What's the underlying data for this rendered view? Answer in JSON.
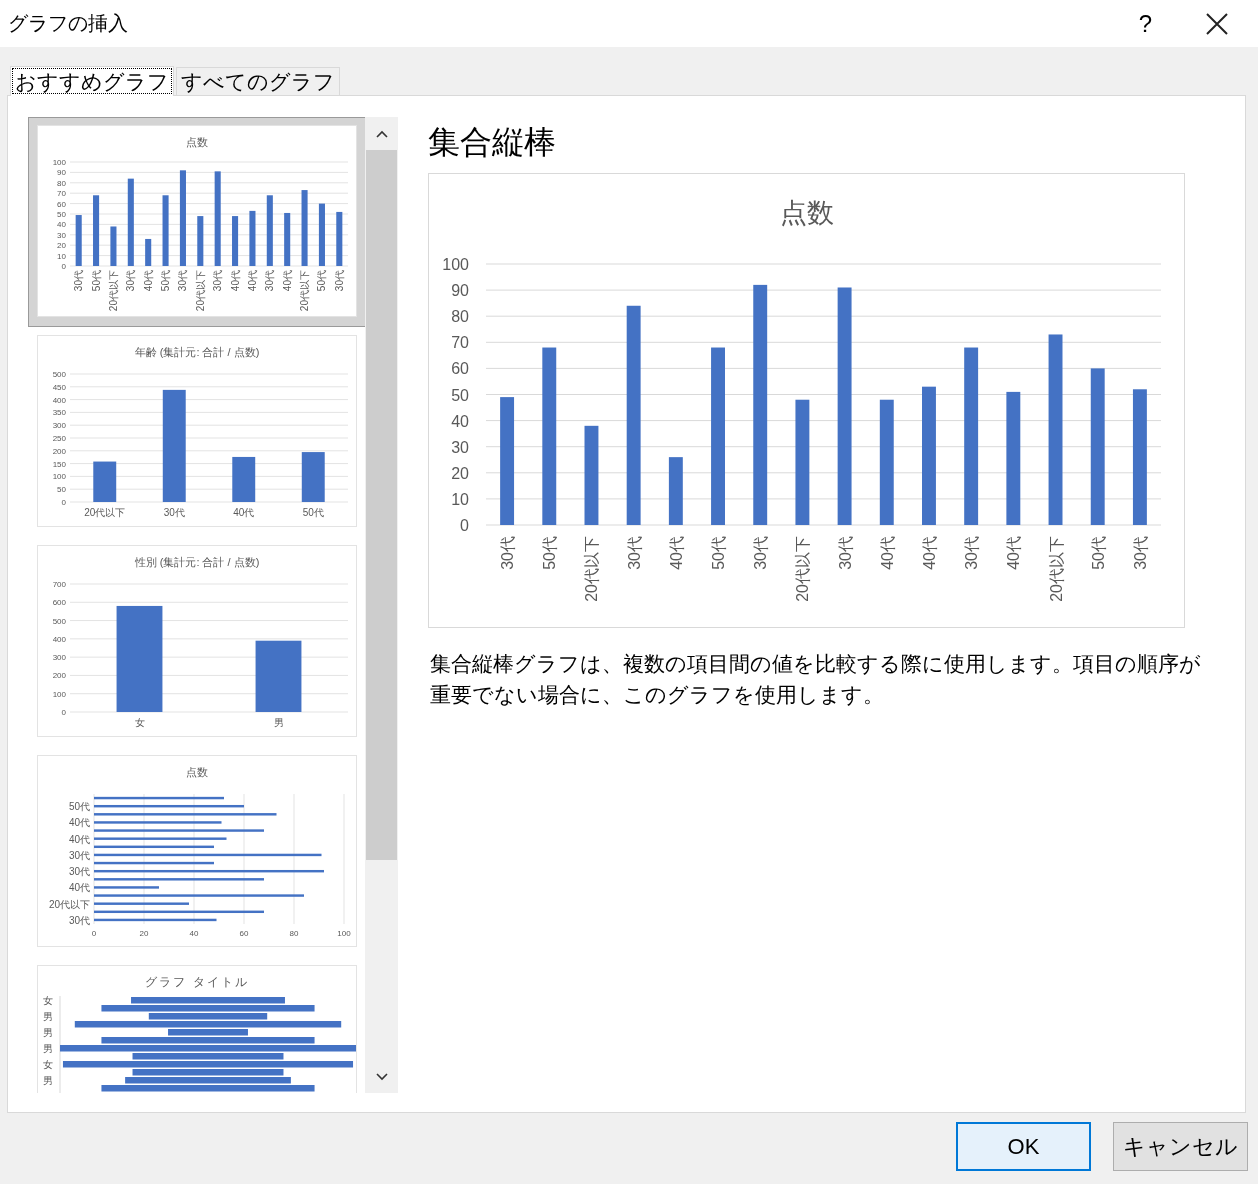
{
  "window": {
    "title": "グラフの挿入",
    "help": "?"
  },
  "tabs": [
    {
      "label": "おすすめグラフ",
      "selected": true
    },
    {
      "label": "すべてのグラフ",
      "selected": false
    }
  ],
  "recommendations": [
    {
      "kind": "chart",
      "selected": true,
      "chart_data": {
        "type": "bar",
        "orientation": "vertical",
        "grid": true,
        "title": "点数",
        "categories": [
          "30代",
          "50代",
          "20代以下",
          "30代",
          "40代",
          "50代",
          "30代",
          "20代以下",
          "30代",
          "40代",
          "40代",
          "30代",
          "40代",
          "20代以下",
          "50代",
          "30代"
        ],
        "series": [
          {
            "color": "#4472c4",
            "values": [
              49,
              68,
              38,
              84,
              26,
              68,
              92,
              48,
              91,
              48,
              53,
              68,
              51,
              73,
              60,
              52
            ]
          }
        ],
        "ylim": [
          0,
          100
        ],
        "yticks": [
          0,
          10,
          20,
          30,
          40,
          50,
          60,
          70,
          80,
          90,
          100
        ]
      }
    },
    {
      "kind": "chart",
      "selected": false,
      "chart_data": {
        "type": "bar",
        "orientation": "vertical",
        "grid": true,
        "title": "年齢 (集計元: 合計 / 点数)",
        "categories": [
          "20代以下",
          "30代",
          "40代",
          "50代"
        ],
        "series": [
          {
            "color": "#4472c4",
            "values": [
              158,
              438,
              176,
              195
            ]
          }
        ],
        "ylim": [
          0,
          500
        ],
        "yticks": [
          0,
          50,
          100,
          150,
          200,
          250,
          300,
          350,
          400,
          450,
          500
        ]
      }
    },
    {
      "kind": "chart",
      "selected": false,
      "chart_data": {
        "type": "bar",
        "orientation": "vertical",
        "grid": true,
        "title": "性別 (集計元: 合計 / 点数)",
        "categories": [
          "女",
          "男"
        ],
        "series": [
          {
            "color": "#4472c4",
            "values": [
              580,
              390
            ]
          }
        ],
        "ylim": [
          0,
          700
        ],
        "yticks": [
          0,
          100,
          200,
          300,
          400,
          500,
          600,
          700
        ]
      }
    },
    {
      "kind": "chart",
      "selected": false,
      "chart_data": {
        "type": "bar",
        "orientation": "horizontal",
        "grid": true,
        "title": "点数",
        "categories": [
          null,
          "50代",
          null,
          "40代",
          null,
          "40代",
          null,
          "30代",
          null,
          "30代",
          null,
          "40代",
          null,
          "20代以下",
          null,
          "30代"
        ],
        "series": [
          {
            "color": "#4472c4",
            "values": [
              52,
              60,
              73,
              51,
              68,
              53,
              48,
              91,
              48,
              92,
              68,
              26,
              84,
              38,
              68,
              49
            ]
          }
        ],
        "xlim": [
          0,
          100
        ],
        "xticks": [
          0,
          20,
          40,
          60,
          80,
          100
        ]
      }
    },
    {
      "kind": "pyramid",
      "selected": false,
      "title": "グラフ タイトル",
      "labels": [
        "女",
        "男",
        "男",
        "男",
        "女",
        "男"
      ]
    }
  ],
  "preview": {
    "title": "集合縦棒",
    "chart_data": {
      "type": "bar",
      "orientation": "vertical",
      "grid": true,
      "title": "点数",
      "categories": [
        "30代",
        "50代",
        "20代以下",
        "30代",
        "40代",
        "50代",
        "30代",
        "20代以下",
        "30代",
        "40代",
        "40代",
        "30代",
        "40代",
        "20代以下",
        "50代",
        "30代"
      ],
      "series": [
        {
          "color": "#4472c4",
          "values": [
            49,
            68,
            38,
            84,
            26,
            68,
            92,
            48,
            91,
            48,
            53,
            68,
            51,
            73,
            60,
            52
          ]
        }
      ],
      "ylim": [
        0,
        100
      ],
      "yticks": [
        0,
        10,
        20,
        30,
        40,
        50,
        60,
        70,
        80,
        90,
        100
      ]
    },
    "description": "集合縦棒グラフは、複数の項目間の値を比較する際に使用します。項目の順序が重要でない場合に、このグラフを使用します。"
  },
  "buttons": [
    {
      "label": "OK",
      "default": true
    },
    {
      "label": "キャンセル",
      "default": false
    }
  ]
}
